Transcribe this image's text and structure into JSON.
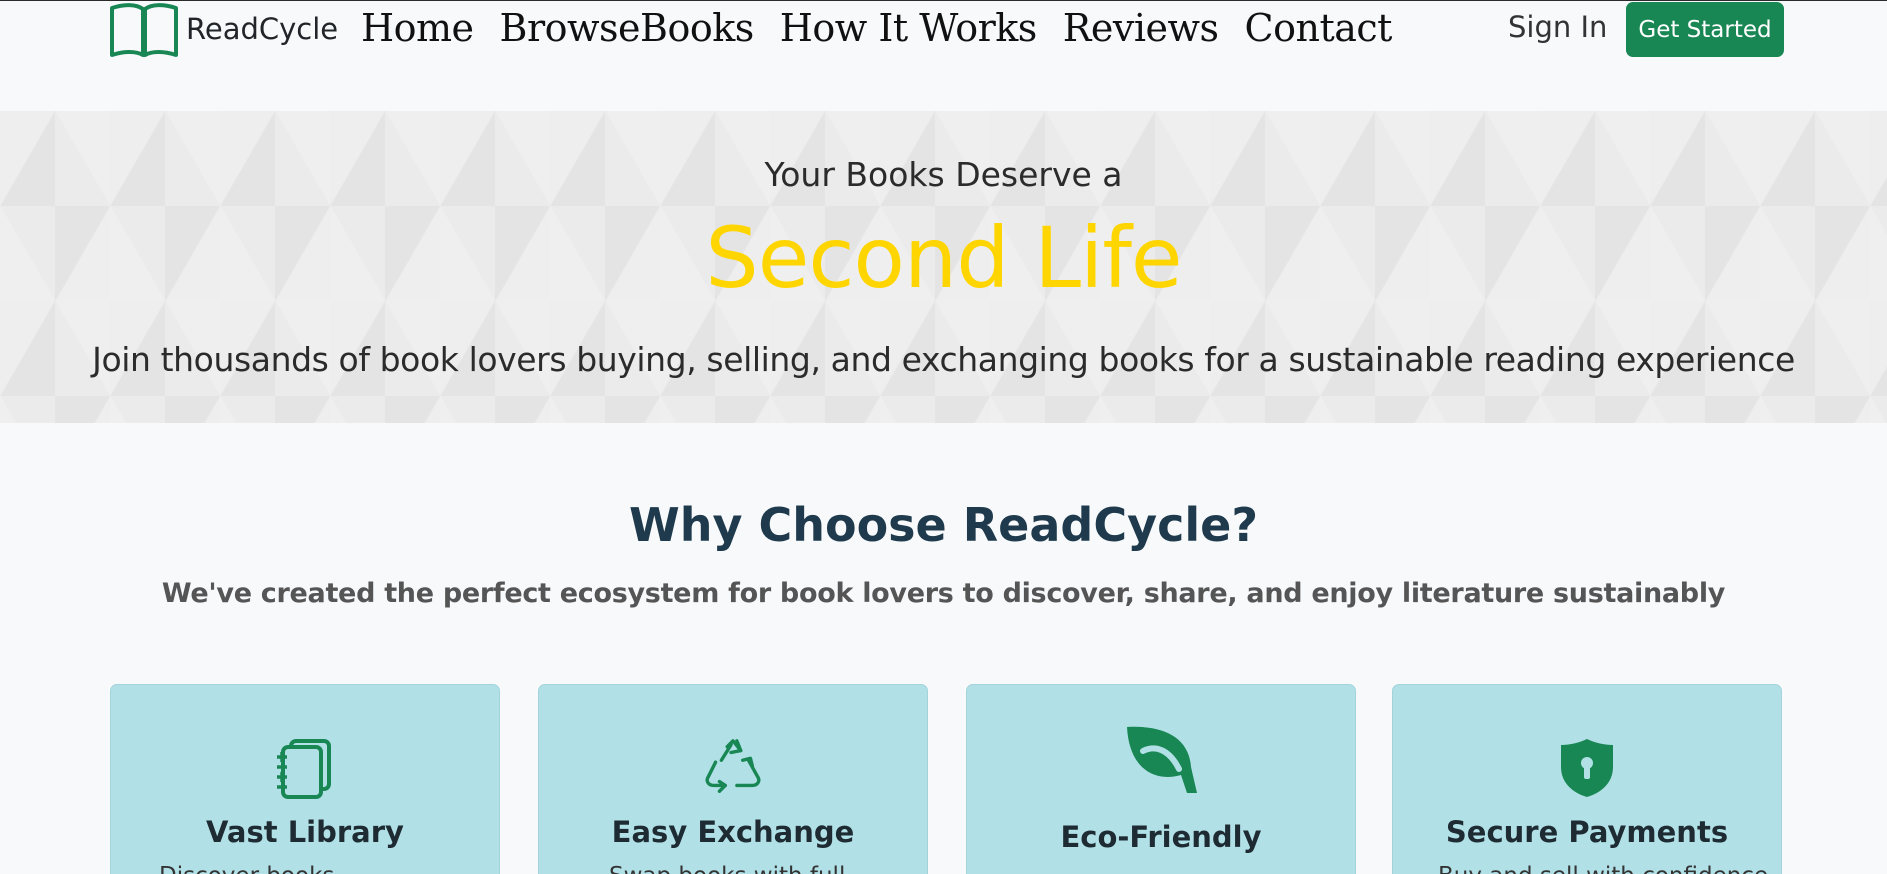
{
  "nav": {
    "brand": "ReadCycle",
    "links": [
      "Home",
      "BrowseBooks",
      "How It Works",
      "Reviews",
      "Contact"
    ],
    "sign_in": "Sign In",
    "get_started": "Get Started",
    "accent": "#198754"
  },
  "hero": {
    "pre_title": "Your Books Deserve a",
    "title": "Second Life",
    "subtitle": "Join thousands of book lovers buying, selling, and exchanging books for a sustainable reading experience",
    "title_color": "#ffd500"
  },
  "why": {
    "title": "Why Choose ReadCycle?",
    "subtitle": "We've created the perfect ecosystem for book lovers to discover, share, and enjoy literature sustainably"
  },
  "features": [
    {
      "title": "Vast Library",
      "icon": "journals-icon",
      "desc": "Discover books..."
    },
    {
      "title": "Easy Exchange",
      "icon": "recycle-icon",
      "desc": "Swap books with full..."
    },
    {
      "title": "Eco-Friendly",
      "icon": "leaf-icon",
      "desc": ""
    },
    {
      "title": "Secure Payments",
      "icon": "shield-lock-icon",
      "desc": "Buy and sell with confidence"
    }
  ]
}
